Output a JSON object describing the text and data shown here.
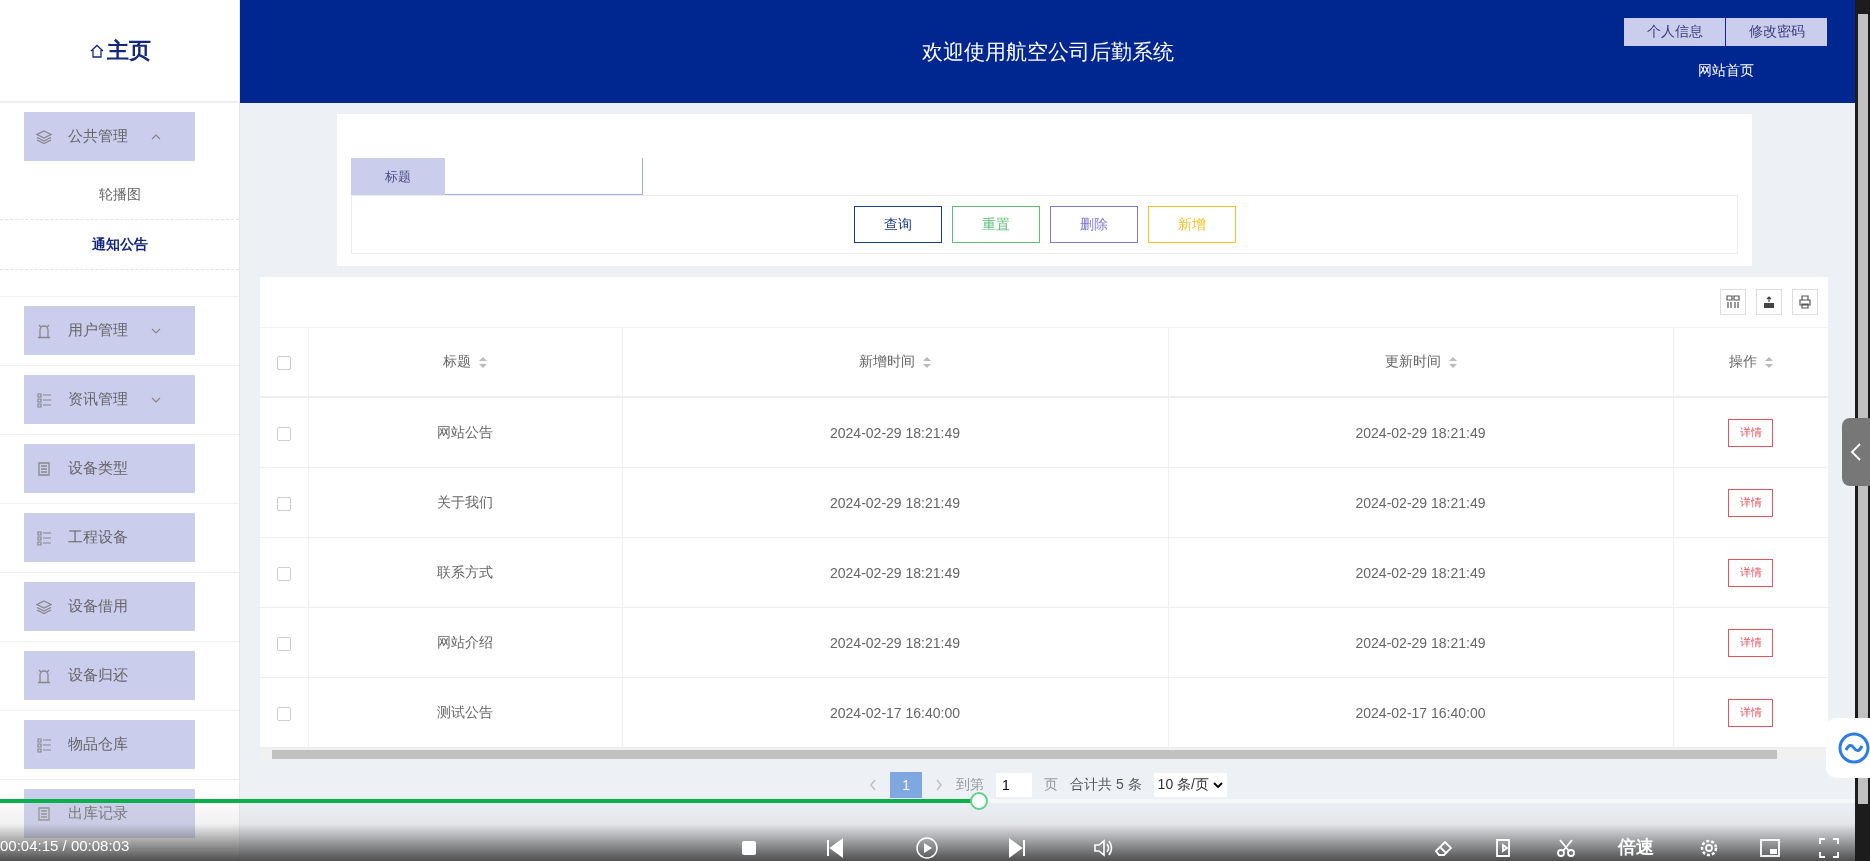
{
  "sidebar": {
    "home": "主页",
    "items": [
      {
        "label": "公共管理",
        "kind": "layers",
        "expanded": true,
        "children": [
          {
            "label": "轮播图",
            "selected": false
          },
          {
            "label": "通知公告",
            "selected": true
          }
        ]
      },
      {
        "label": "用户管理",
        "kind": "alarm",
        "expanded": false
      },
      {
        "label": "资讯管理",
        "kind": "list",
        "expanded": false
      },
      {
        "label": "设备类型",
        "kind": "doc"
      },
      {
        "label": "工程设备",
        "kind": "list"
      },
      {
        "label": "设备借用",
        "kind": "layers"
      },
      {
        "label": "设备归还",
        "kind": "alarm"
      },
      {
        "label": "物品仓库",
        "kind": "list"
      },
      {
        "label": "出库记录",
        "kind": "doc"
      }
    ]
  },
  "header": {
    "title": "欢迎使用航空公司后勤系统",
    "buttons": [
      "个人信息",
      "修改密码"
    ],
    "home_link": "网站首页"
  },
  "search": {
    "label": "标题",
    "buttons": [
      {
        "label": "查询",
        "kind": "query"
      },
      {
        "label": "重置",
        "kind": "reset"
      },
      {
        "label": "删除",
        "kind": "delete"
      },
      {
        "label": "新增",
        "kind": "add"
      }
    ]
  },
  "table": {
    "select_all_checked": false,
    "columns": [
      "标题",
      "新增时间",
      "更新时间",
      "操作"
    ],
    "rows": [
      {
        "checked": false,
        "title": "网站公告",
        "created": "2024-02-29 18:21:49",
        "updated": "2024-02-29 18:21:49",
        "action": "详情"
      },
      {
        "checked": false,
        "title": "关于我们",
        "created": "2024-02-29 18:21:49",
        "updated": "2024-02-29 18:21:49",
        "action": "详情"
      },
      {
        "checked": false,
        "title": "联系方式",
        "created": "2024-02-29 18:21:49",
        "updated": "2024-02-29 18:21:49",
        "action": "详情"
      },
      {
        "checked": false,
        "title": "网站介绍",
        "created": "2024-02-29 18:21:49",
        "updated": "2024-02-29 18:21:49",
        "action": "详情"
      },
      {
        "checked": false,
        "title": "测试公告",
        "created": "2024-02-17 16:40:00",
        "updated": "2024-02-17 16:40:00",
        "action": "详情"
      }
    ]
  },
  "pagination": {
    "pages": [
      {
        "label": "1",
        "selected": true
      }
    ],
    "goto_label": "到第",
    "goto_value": "1",
    "page_unit": "页",
    "total": "合计共 5 条",
    "page_size": "10 条/页"
  },
  "player": {
    "level": 0.528,
    "time": "00:04:15 / 00:08:03",
    "speed": "倍速"
  }
}
